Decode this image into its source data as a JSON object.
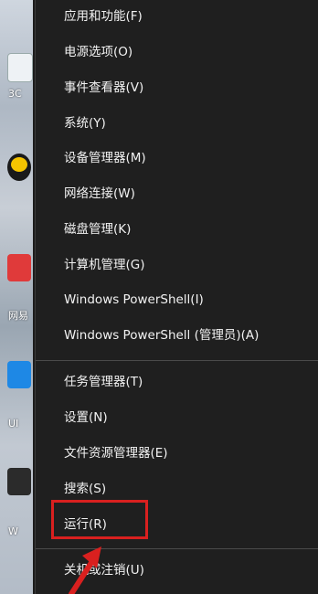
{
  "desktop": {
    "icons": [
      {
        "name": "desktop-icon-1",
        "label": "3C",
        "color": "#e8eef3"
      },
      {
        "name": "desktop-icon-2",
        "label": "",
        "color": "#f5c400"
      },
      {
        "name": "desktop-icon-3",
        "label": "网易",
        "color": "#e03a3a"
      },
      {
        "name": "desktop-icon-4",
        "label": "UI",
        "color": "#1e88e5"
      },
      {
        "name": "desktop-icon-5",
        "label": "W",
        "color": "#2b2b2b"
      }
    ]
  },
  "menu": {
    "group1": [
      {
        "label": "应用和功能(F)"
      },
      {
        "label": "电源选项(O)"
      },
      {
        "label": "事件查看器(V)"
      },
      {
        "label": "系统(Y)"
      },
      {
        "label": "设备管理器(M)"
      },
      {
        "label": "网络连接(W)"
      },
      {
        "label": "磁盘管理(K)"
      },
      {
        "label": "计算机管理(G)"
      },
      {
        "label": "Windows PowerShell(I)"
      },
      {
        "label": "Windows PowerShell (管理员)(A)"
      }
    ],
    "group2": [
      {
        "label": "任务管理器(T)"
      },
      {
        "label": "设置(N)"
      },
      {
        "label": "文件资源管理器(E)"
      },
      {
        "label": "搜索(S)"
      },
      {
        "label": "运行(R)"
      }
    ],
    "group3": [
      {
        "label": "关机或注销(U)"
      }
    ]
  },
  "annotation": {
    "highlight_color": "#d9201f"
  }
}
